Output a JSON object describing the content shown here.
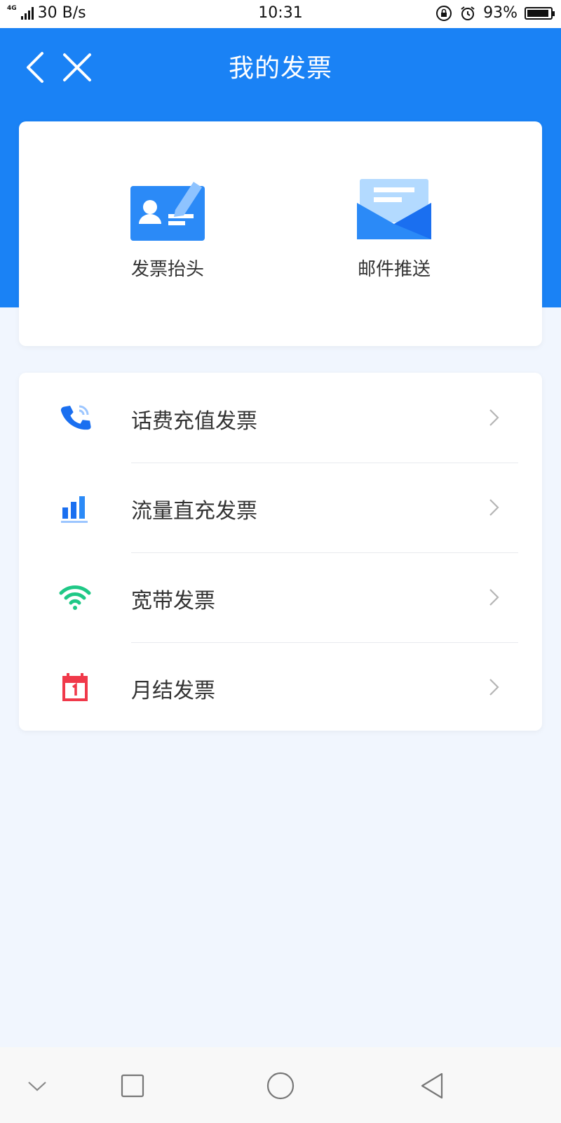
{
  "status_bar": {
    "network_type": "4G",
    "speed": "30 B/s",
    "time": "10:31",
    "battery_percent": "93%",
    "battery_level": 0.93
  },
  "header": {
    "title": "我的发票",
    "back_icon": "chevron-left-icon",
    "close_icon": "close-icon"
  },
  "quick_actions": [
    {
      "label": "发票抬头",
      "icon": "id-card-pen-icon"
    },
    {
      "label": "邮件推送",
      "icon": "envelope-icon"
    }
  ],
  "invoice_list": [
    {
      "label": "话费充值发票",
      "icon": "phone-icon",
      "color": "#1a6ff0"
    },
    {
      "label": "流量直充发票",
      "icon": "bar-chart-icon",
      "color": "#1a6ff0"
    },
    {
      "label": "宽带发票",
      "icon": "wifi-icon",
      "color": "#1fc886"
    },
    {
      "label": "月结发票",
      "icon": "calendar-icon",
      "color": "#f0394a"
    }
  ],
  "colors": {
    "brand": "#1a82f5",
    "background": "#f1f6fe"
  }
}
